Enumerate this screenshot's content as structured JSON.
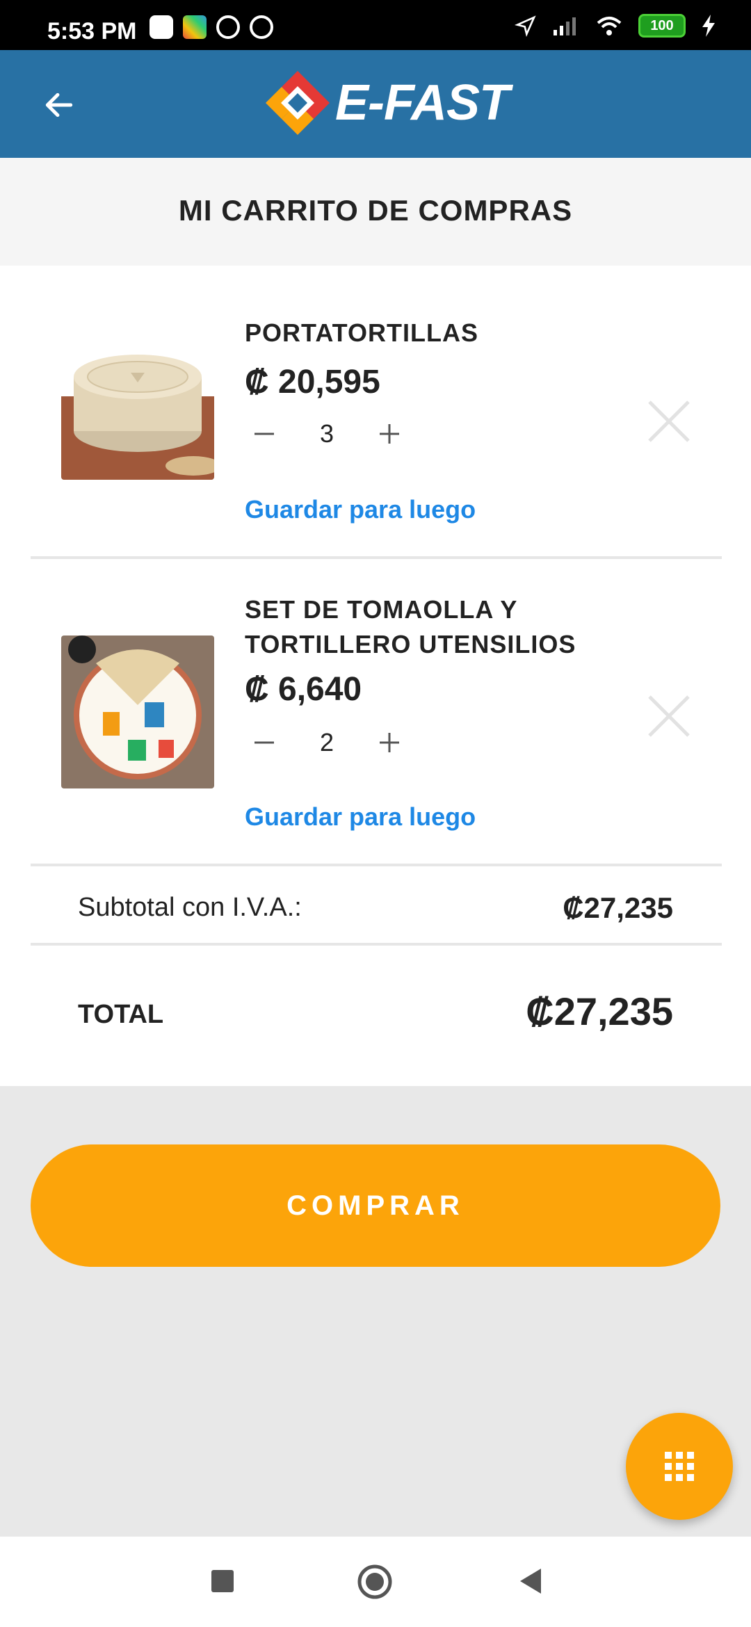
{
  "status_bar": {
    "time": "5:53 PM",
    "battery": "100",
    "left_icons": [
      "notification-icon",
      "app-icon",
      "circle-app-icon",
      "circle-app-icon"
    ],
    "right_icons": [
      "location-icon",
      "signal-icon",
      "wifi-icon",
      "battery-icon",
      "charging-icon"
    ]
  },
  "app_bar": {
    "back_icon": "arrow-left-icon",
    "logo_text": "E-FAST"
  },
  "page": {
    "title": "MI CARRITO DE COMPRAS"
  },
  "cart": {
    "items": [
      {
        "name_lines": [
          "PORTATORTILLAS"
        ],
        "price": "₡ 20,595",
        "quantity": "3",
        "save_label": "Guardar para luego"
      },
      {
        "name_lines": [
          "SET DE TOMAOLLA Y",
          "TORTILLERO UTENSILIOS"
        ],
        "price": "₡ 6,640",
        "quantity": "2",
        "save_label": "Guardar para luego"
      }
    ],
    "subtotal_label": "Subtotal con I.V.A.:",
    "subtotal_value": "₡27,235",
    "total_label": "TOTAL",
    "total_value": "₡27,235"
  },
  "actions": {
    "buy_label": "COMPRAR",
    "fab_icon": "grid-menu-icon"
  },
  "colors": {
    "primary": "#2871a4",
    "accent": "#fca40a",
    "link": "#1e88e5"
  }
}
